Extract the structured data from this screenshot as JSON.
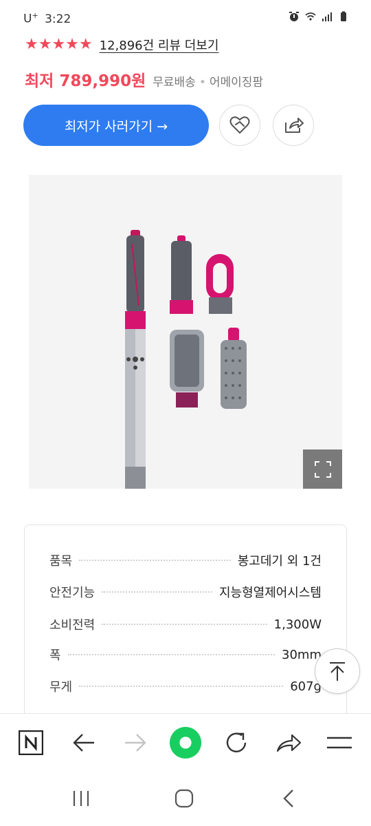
{
  "status_bar": {
    "carrier": "U",
    "carrier_sup": "+",
    "time": "3:22",
    "icons": [
      "alarm-icon",
      "wifi-icon",
      "signal-icon",
      "battery-icon"
    ]
  },
  "rating": {
    "stars": 5,
    "star_glyph": "★★★★★",
    "review_link": "12,896건 리뷰 더보기"
  },
  "price": {
    "label": "최저 789,990원",
    "shipping": "무료배송",
    "separator": "•",
    "seller": "어메이징팜"
  },
  "actions": {
    "buy_label": "최저가 사러가기 →",
    "wish_icon": "heart-icon",
    "share_icon": "share-icon"
  },
  "product_image": {
    "description_icon": "product-photo",
    "expand_icon": "expand-icon"
  },
  "specs": [
    {
      "label": "품목",
      "value": "봉고데기 외 1건"
    },
    {
      "label": "안전기능",
      "value": "지능형열제어시스템"
    },
    {
      "label": "소비전력",
      "value": "1,300W"
    },
    {
      "label": "폭",
      "value": "30mm"
    },
    {
      "label": "무게",
      "value": "607g"
    }
  ],
  "browser_toolbar": {
    "items": [
      "naver-home-icon",
      "back-arrow-icon",
      "forward-arrow-icon",
      "green-dot-icon",
      "refresh-icon",
      "share-arrow-icon",
      "menu-icon"
    ]
  },
  "android_nav": {
    "items": [
      "recent-apps-icon",
      "home-icon",
      "back-icon"
    ]
  },
  "colors": {
    "accent_red": "#f0495b",
    "button_blue": "#2e7cf0",
    "green": "#19ce60"
  }
}
